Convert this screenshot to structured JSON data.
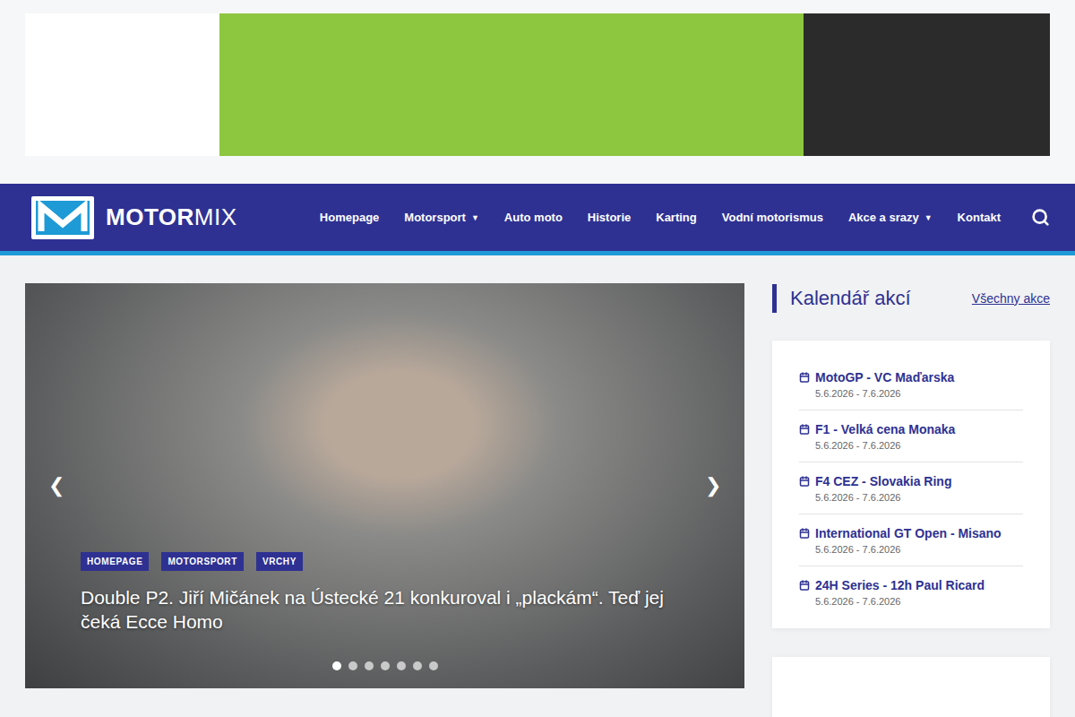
{
  "nav": {
    "logo": {
      "bold": "MOTOR",
      "light": "MIX"
    },
    "items": [
      {
        "label": "Homepage",
        "caret": null
      },
      {
        "label": "Motorsport",
        "caret": "▼"
      },
      {
        "label": "Auto moto",
        "caret": null
      },
      {
        "label": "Historie",
        "caret": null
      },
      {
        "label": "Karting",
        "caret": null
      },
      {
        "label": "Vodní motorismus",
        "caret": null
      },
      {
        "label": "Akce a srazy",
        "caret": "▼"
      },
      {
        "label": "Kontakt",
        "caret": null
      }
    ]
  },
  "slider": {
    "prev": "❮",
    "next": "❯",
    "tags": [
      "HOMEPAGE",
      "MOTORSPORT",
      "VRCHY"
    ],
    "title": "Double P2. Jiří Mičánek na Ústecké 21 konkuroval i „plackám“. Teď jej čeká Ecce Homo",
    "dots": [
      {
        "selected": true
      },
      {
        "selected": false
      },
      {
        "selected": false
      },
      {
        "selected": false
      },
      {
        "selected": false
      },
      {
        "selected": false
      },
      {
        "selected": false
      }
    ]
  },
  "calendar": {
    "title": "Kalendář akcí",
    "link": "Všechny akce",
    "events": [
      {
        "title": "MotoGP - VC Maďarska",
        "dates": "5.6.2026 - 7.6.2026"
      },
      {
        "title": "F1 - Velká cena Monaka",
        "dates": "5.6.2026 - 7.6.2026"
      },
      {
        "title": "F4 CEZ - Slovakia Ring",
        "dates": "5.6.2026 - 7.6.2026"
      },
      {
        "title": "International GT Open - Misano",
        "dates": "5.6.2026 - 7.6.2026"
      },
      {
        "title": "24H Series - 12h Paul Ricard",
        "dates": "5.6.2026 - 7.6.2026"
      }
    ]
  }
}
